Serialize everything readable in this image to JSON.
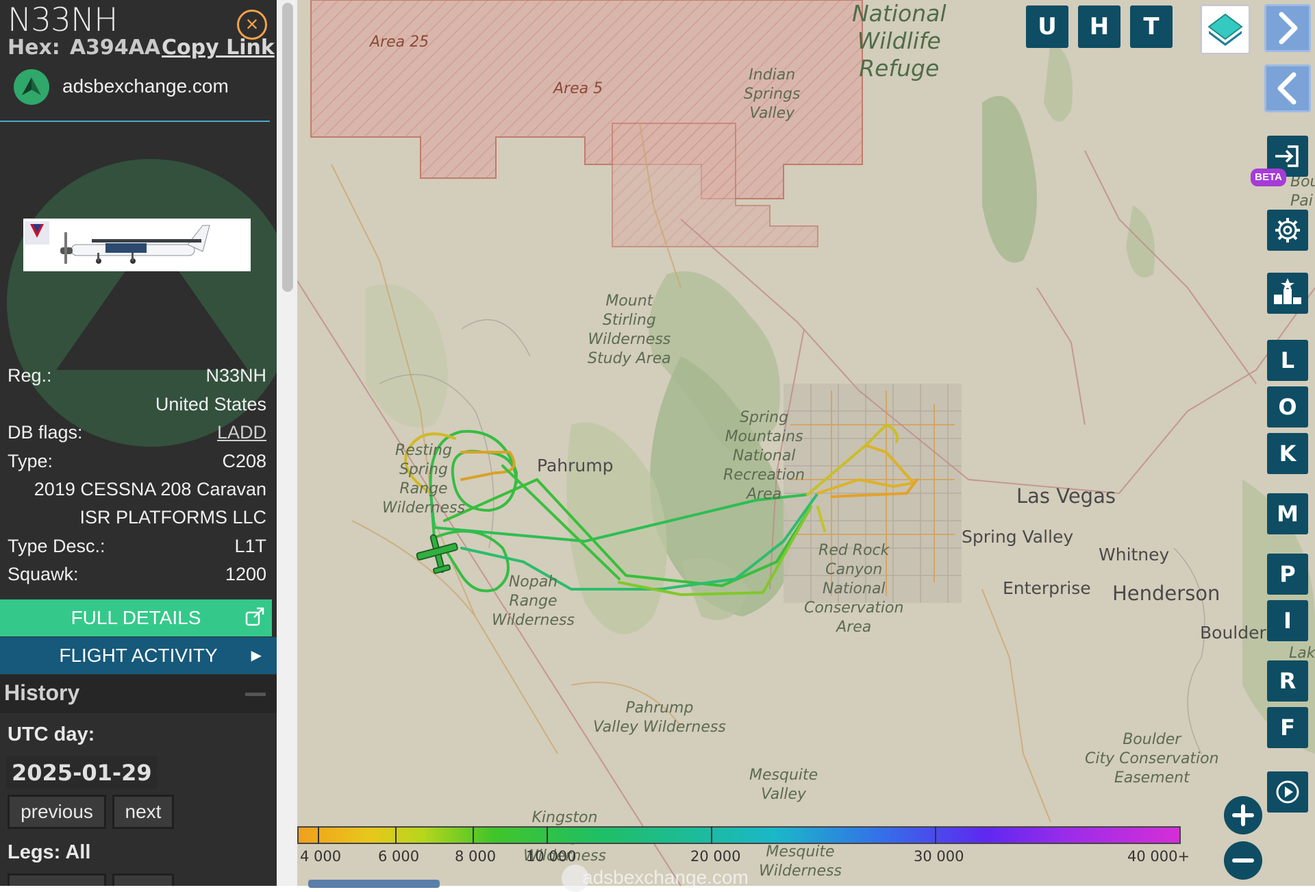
{
  "aircraft": {
    "callsign": "N33NH",
    "hex_label": "Hex:",
    "hex": "A394AA",
    "copy_link": "Copy Link",
    "source": "adsbexchange.com"
  },
  "details": {
    "reg_label": "Reg.:",
    "reg": "N33NH",
    "country": "United States",
    "db_flags_label": "DB flags:",
    "db_flags": "LADD",
    "type_label": "Type:",
    "type": "C208",
    "model": "2019 CESSNA 208 Caravan",
    "owner": "ISR PLATFORMS LLC",
    "type_desc_label": "Type Desc.:",
    "type_desc": "L1T",
    "squawk_label": "Squawk:",
    "squawk": "1200"
  },
  "buttons": {
    "full_details": "FULL DETAILS",
    "flight_activity": "FLIGHT ACTIVITY"
  },
  "history": {
    "title": "History",
    "utc_label": "UTC day:",
    "utc_date": "2025-01-29",
    "previous": "previous",
    "next": "next",
    "legs": "Legs: All"
  },
  "map_controls": {
    "top": [
      "U",
      "H",
      "T"
    ],
    "beta": "BETA",
    "side_letters": [
      "L",
      "O",
      "K",
      "M",
      "P",
      "I",
      "R",
      "F"
    ]
  },
  "map_labels": {
    "area25": "Area 25",
    "area5": "Area 5",
    "indian_springs": "Indian\nSprings\nValley",
    "refuge": "National\nWildlife\nRefuge",
    "mount_stirling": "Mount\nStirling\nWilderness\nStudy Area",
    "resting_spring": "Resting\nSpring\nRange\nWilderness",
    "pahrump": "Pahrump",
    "pahrump_valley": "Pahrump\nValley",
    "spring_mountains": "Spring\nMountains\nNational\nRecreation\nArea",
    "nopah": "Nopah\nRange\nWilderness",
    "red_rock": "Red Rock\nCanyon\nNational\nConservation\nArea",
    "las_vegas": "Las Vegas",
    "spring_valley": "Spring Valley",
    "whitney": "Whitney",
    "enterprise": "Enterprise",
    "henderson": "Henderson",
    "boulder_city": "Boulder C",
    "pahrump_wilderness": "Pahrump\nValley Wilderness",
    "mesquite_valley": "Mesquite\nValley",
    "boulder_cons": "Boulder\nCity Conservation\nEasement",
    "kingston": "Kingston\nRange\nWilderness",
    "mesquite_wild": "Mesquite\nWilderness",
    "bou_pai": "Bou\nPai",
    "lak": "Lak"
  },
  "altitude_legend": [
    "4 000",
    "6 000",
    "8 000",
    "10 000",
    "20 000",
    "30 000",
    "40 000+"
  ],
  "watermark": "adsbexchange.com",
  "colors": {
    "sidebar_bg": "#2e2e2e",
    "accent_green": "#34c98a",
    "flight_blue": "#16597a",
    "control_teal": "#0e4d63",
    "close_orange": "#f2a24a",
    "beta_purple": "#a63bd8"
  }
}
